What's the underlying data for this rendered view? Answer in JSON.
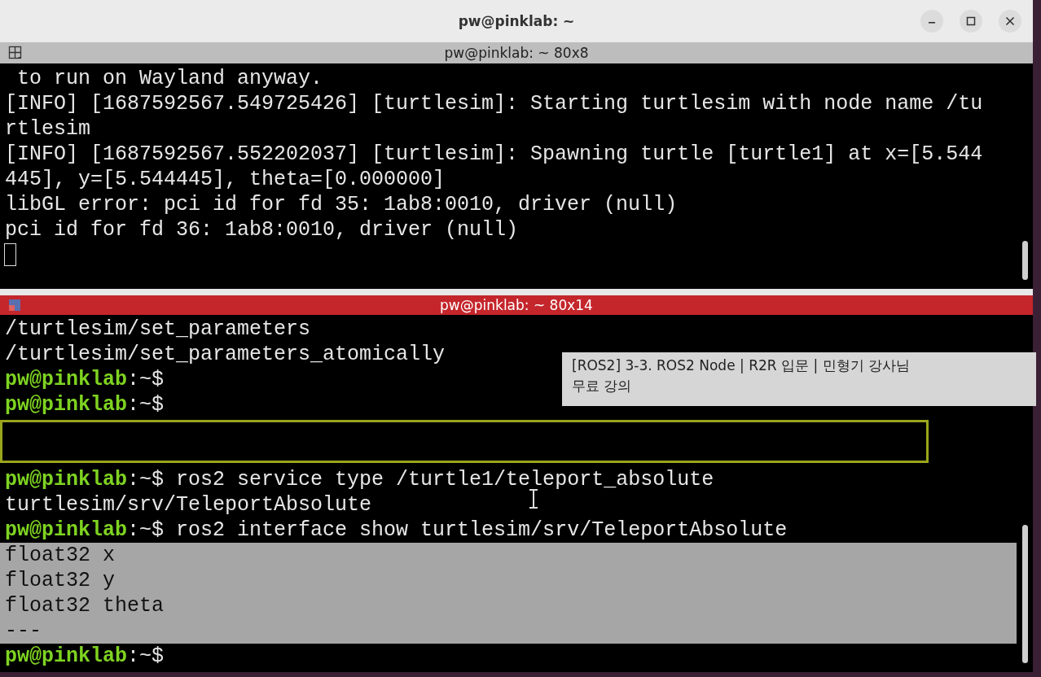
{
  "window": {
    "title": "pw@pinklab: ~"
  },
  "panes": [
    {
      "title": "pw@pinklab: ~ 80x8",
      "active": false,
      "lines": [
        {
          "kind": "output",
          "text": " to run on Wayland anyway."
        },
        {
          "kind": "output",
          "text": "[INFO] [1687592567.549725426] [turtlesim]: Starting turtlesim with node name /tu"
        },
        {
          "kind": "output",
          "text": "rtlesim"
        },
        {
          "kind": "output",
          "text": "[INFO] [1687592567.552202037] [turtlesim]: Spawning turtle [turtle1] at x=[5.544"
        },
        {
          "kind": "output",
          "text": "445], y=[5.544445], theta=[0.000000]"
        },
        {
          "kind": "output",
          "text": "libGL error: pci id for fd 35: 1ab8:0010, driver (null)"
        },
        {
          "kind": "output",
          "text": "pci id for fd 36: 1ab8:0010, driver (null)"
        },
        {
          "kind": "cursor"
        }
      ]
    },
    {
      "title": "pw@pinklab: ~ 80x14",
      "active": true,
      "lines": [
        {
          "kind": "output",
          "text": "/turtlesim/set_parameters",
          "selected": false
        },
        {
          "kind": "output",
          "text": "/turtlesim/set_parameters_atomically",
          "selected": false
        },
        {
          "kind": "prompt",
          "user": "pw@pinklab",
          "rest": ":~$",
          "selected": false
        },
        {
          "kind": "prompt",
          "user": "pw@pinklab",
          "rest": ":~$",
          "selected": false
        },
        {
          "kind": "box"
        },
        {
          "kind": "prompt",
          "user": "pw@pinklab",
          "rest": ":~$",
          "command": " ros2 service type /turtle1/teleport_absolute",
          "selected": false
        },
        {
          "kind": "output",
          "text": "turtlesim/srv/TeleportAbsolute",
          "selected": false
        },
        {
          "kind": "prompt",
          "user": "pw@pinklab",
          "rest": ":~$",
          "command": " ros2 interface show turtlesim/srv/TeleportAbsolute",
          "selected": false
        },
        {
          "kind": "output",
          "text": "float32 x",
          "selected": true
        },
        {
          "kind": "output",
          "text": "float32 y",
          "selected": true
        },
        {
          "kind": "output",
          "text": "float32 theta",
          "selected": true
        },
        {
          "kind": "output",
          "text": "---",
          "selected": true
        },
        {
          "kind": "prompt",
          "user": "pw@pinklab",
          "rest": ":~$",
          "selected": false
        }
      ]
    }
  ],
  "caption": {
    "lines": [
      "[ROS2] 3-3. ROS2 Node | R2R 입문 | 민형기 강사님",
      "무료 강의"
    ]
  }
}
